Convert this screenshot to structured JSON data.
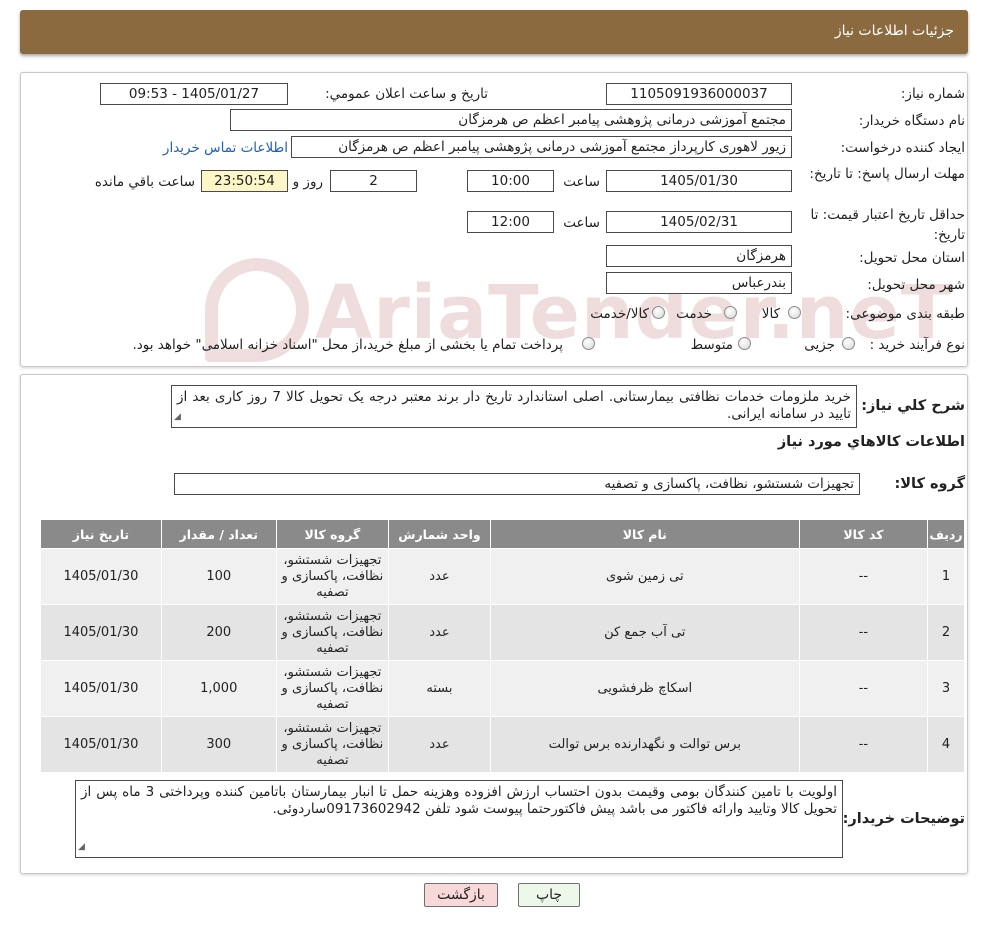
{
  "header": {
    "title": "جزئیات اطلاعات نیاز"
  },
  "labels": {
    "need_number": "شماره نیاز:",
    "announce_datetime": "تاریخ و ساعت اعلان عمومي:",
    "buyer_org": "نام دستگاه خریدار:",
    "requester": "ایجاد کننده درخواست:",
    "buyer_contact": "اطلاعات تماس خریدار",
    "reply_deadline": "مهلت ارسال پاسخ: تا تاریخ:",
    "time_word": "ساعت",
    "day_and": "روز و",
    "hours_remaining": "ساعت باقي مانده",
    "price_validity": "حداقل تاريخ اعتبار قيمت: تا تاریخ:",
    "delivery_province": "استان محل تحویل:",
    "delivery_city": "شهر محل تحویل:",
    "subject_category": "طبقه بندی موضوعی:",
    "purchase_type": "نوع فرآیند خرید :",
    "summary": "شرح کلي نياز:",
    "goods_info": "اطلاعات کالاهاي مورد نياز",
    "goods_group": "گروه کالا:",
    "buyer_notes": "توضیحات خریدار:"
  },
  "values": {
    "need_number": "1105091936000037",
    "announce_datetime": "1405/01/27 - 09:53",
    "buyer_org": "مجتمع آموزشی درمانی پژوهشی پیامبر اعظم ص  هرمزگان",
    "requester": "زیور لاهوری کارپرداز مجتمع آموزشی درمانی پژوهشی پیامبر اعظم ص  هرمزگان",
    "reply_date": "1405/01/30",
    "reply_time": "10:00",
    "days": "2",
    "remaining_time": "23:50:54",
    "validity_date": "1405/02/31",
    "validity_time": "12:00",
    "province": "هرمزگان",
    "city": "بندرعباس",
    "goods_group": "تجهیزات شستشو، نظافت، پاکسازی و تصفیه"
  },
  "category_options": [
    "کالا",
    "خدمت",
    "کالا/خدمت"
  ],
  "purchase_options": [
    "جزیی",
    "متوسط"
  ],
  "purchase_note": "پرداخت تمام یا بخشی از مبلغ خرید،از محل \"اسناد خزانه اسلامی\" خواهد بود.",
  "summary_text": "خرید ملزومات خدمات نظافتی بیمارستانی. اصلی  استاندارد تاریخ دار  برند معتبر درجه یک تحویل کالا 7 روز کاری بعد از تایید در سامانه ایرانی.",
  "table": {
    "headers": [
      "ردیف",
      "کد کالا",
      "نام کالا",
      "واحد شمارش",
      "گروه کالا",
      "تعداد / مقدار",
      "تاریخ نیاز"
    ],
    "rows": [
      [
        "1",
        "--",
        "تی زمین شوی",
        "عدد",
        "تجهیزات شستشو، نظافت، پاکسازی و تصفیه",
        "100",
        "1405/01/30"
      ],
      [
        "2",
        "--",
        "تی آب جمع کن",
        "عدد",
        "تجهیزات شستشو، نظافت، پاکسازی و تصفیه",
        "200",
        "1405/01/30"
      ],
      [
        "3",
        "--",
        "اسکاچ ظرفشویی",
        "بسته",
        "تجهیزات شستشو، نظافت، پاکسازی و تصفیه",
        "1,000",
        "1405/01/30"
      ],
      [
        "4",
        "--",
        "برس توالت و نگهدارنده برس توالت",
        "عدد",
        "تجهیزات شستشو، نظافت، پاکسازی و تصفیه",
        "300",
        "1405/01/30"
      ]
    ]
  },
  "notes_text": "اولویت با تامین کنندگان بومی وقیمت بدون احتساب ارزش افزوده وهزینه حمل تا انبار بیمارستان باتامین کننده وپرداختی 3 ماه پس از تحویل کالا وتایید وارائه فاکتور می باشد پیش فاکتورحتما پیوست شود تلفن 09173602942ساردوئی.",
  "buttons": {
    "print": "چاپ",
    "back": "بازگشت"
  },
  "watermark": "AriaTender.neT",
  "colors": {
    "header": "#8a6a3e",
    "table_header": "#8a8a8a",
    "remaining_bg": "#fdf7c8",
    "back_btn": "#f8d8d8",
    "print_btn": "#eef8ea"
  }
}
